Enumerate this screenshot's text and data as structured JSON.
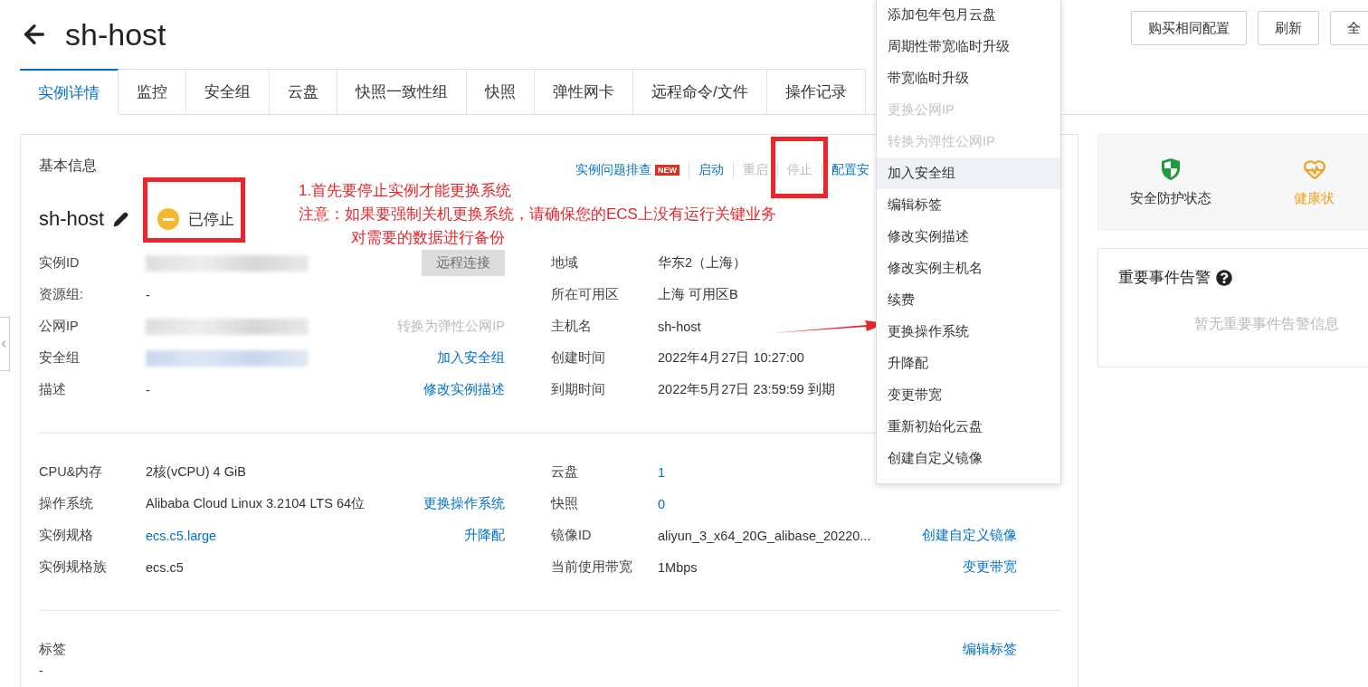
{
  "header": {
    "title": "sh-host",
    "buttons": [
      "购买相同配置",
      "刷新",
      "全"
    ]
  },
  "tabs": [
    {
      "label": "实例详情",
      "selected": true
    },
    {
      "label": "监控",
      "selected": false
    },
    {
      "label": "安全组",
      "selected": false
    },
    {
      "label": "云盘",
      "selected": false
    },
    {
      "label": "快照一致性组",
      "selected": false
    },
    {
      "label": "快照",
      "selected": false
    },
    {
      "label": "弹性网卡",
      "selected": false
    },
    {
      "label": "远程命令/文件",
      "selected": false
    },
    {
      "label": "操作记录",
      "selected": false
    }
  ],
  "basic_info": {
    "title": "基本信息",
    "actions": [
      {
        "label": "实例问题排查",
        "badge": "NEW",
        "disabled": false
      },
      {
        "label": "启动",
        "disabled": false
      },
      {
        "label": "重启",
        "disabled": true
      },
      {
        "label": "停止",
        "disabled": true
      },
      {
        "label": "配置安",
        "disabled": false
      }
    ],
    "instance_name": "sh-host",
    "status": {
      "kind": "stopped",
      "label": "已停止"
    },
    "sections": [
      {
        "left": [
          {
            "label": "实例ID",
            "value": {
              "kind": "redacted"
            },
            "action": {
              "kind": "button",
              "label": "远程连接",
              "disabled": true
            }
          },
          {
            "label": "资源组:",
            "value": {
              "kind": "text",
              "text": "-"
            }
          },
          {
            "label": "公网IP",
            "value": {
              "kind": "redacted"
            },
            "action": {
              "kind": "link",
              "label": "转换为弹性公网IP",
              "disabled": true
            }
          },
          {
            "label": "安全组",
            "value": {
              "kind": "redacted-link"
            },
            "action": {
              "kind": "link",
              "label": "加入安全组",
              "disabled": false
            }
          },
          {
            "label": "描述",
            "value": {
              "kind": "text",
              "text": "-"
            },
            "action": {
              "kind": "link",
              "label": "修改实例描述",
              "disabled": false
            }
          }
        ],
        "right": [
          {
            "label": "地域",
            "value": {
              "kind": "text",
              "text": "华东2（上海）"
            }
          },
          {
            "label": "所在可用区",
            "value": {
              "kind": "text",
              "text": "上海 可用区B"
            }
          },
          {
            "label": "主机名",
            "value": {
              "kind": "text",
              "text": "sh-host"
            }
          },
          {
            "label": "创建时间",
            "value": {
              "kind": "text",
              "text": "2022年4月27日 10:27:00"
            }
          },
          {
            "label": "到期时间",
            "value": {
              "kind": "text",
              "text": "2022年5月27日 23:59:59 到期"
            }
          }
        ]
      },
      {
        "left": [
          {
            "label": "CPU&内存",
            "value": {
              "kind": "text",
              "text": "2核(vCPU) 4 GiB"
            }
          },
          {
            "label": "操作系统",
            "value": {
              "kind": "text",
              "text": "Alibaba Cloud Linux 3.2104 LTS 64位"
            },
            "action": {
              "kind": "link",
              "label": "更换操作系统",
              "disabled": false
            }
          },
          {
            "label": "实例规格",
            "value": {
              "kind": "link",
              "text": "ecs.c5.large"
            },
            "action": {
              "kind": "link",
              "label": "升降配",
              "disabled": false
            }
          },
          {
            "label": "实例规格族",
            "value": {
              "kind": "text",
              "text": "ecs.c5"
            }
          }
        ],
        "right": [
          {
            "label": "云盘",
            "value": {
              "kind": "link",
              "text": "1"
            }
          },
          {
            "label": "快照",
            "value": {
              "kind": "link",
              "text": "0"
            }
          },
          {
            "label": "镜像ID",
            "value": {
              "kind": "text",
              "text": "aliyun_3_x64_20G_alibase_20220..."
            },
            "action": {
              "kind": "link",
              "label": "创建自定义镜像",
              "disabled": false
            }
          },
          {
            "label": "当前使用带宽",
            "value": {
              "kind": "text",
              "text": "1Mbps"
            },
            "action": {
              "kind": "link",
              "label": "变更带宽",
              "disabled": false
            }
          }
        ]
      }
    ],
    "tags": {
      "label": "标签",
      "value": "-",
      "action": "编辑标签"
    }
  },
  "more_menu": {
    "items": [
      {
        "label": "添加包年包月云盘",
        "disabled": false,
        "selected": false
      },
      {
        "label": "周期性带宽临时升级",
        "disabled": false,
        "selected": false
      },
      {
        "label": "带宽临时升级",
        "disabled": false,
        "selected": false
      },
      {
        "label": "更换公网IP",
        "disabled": true,
        "selected": false
      },
      {
        "label": "转换为弹性公网IP",
        "disabled": true,
        "selected": false
      },
      {
        "label": "加入安全组",
        "disabled": false,
        "selected": true
      },
      {
        "label": "编辑标签",
        "disabled": false,
        "selected": false
      },
      {
        "label": "修改实例描述",
        "disabled": false,
        "selected": false
      },
      {
        "label": "修改实例主机名",
        "disabled": false,
        "selected": false
      },
      {
        "label": "续费",
        "disabled": false,
        "selected": false
      },
      {
        "label": "更换操作系统",
        "disabled": false,
        "selected": false
      },
      {
        "label": "升降配",
        "disabled": false,
        "selected": false
      },
      {
        "label": "变更带宽",
        "disabled": false,
        "selected": false
      },
      {
        "label": "重新初始化云盘",
        "disabled": false,
        "selected": false
      },
      {
        "label": "创建自定义镜像",
        "disabled": false,
        "selected": false
      }
    ]
  },
  "status_cards": [
    {
      "kind": "security",
      "label": "安全防护状态"
    },
    {
      "kind": "health",
      "label": "健康状"
    }
  ],
  "events": {
    "title": "重要事件告警",
    "empty": "暂无重要事件告警信息"
  },
  "annotation": {
    "notes": [
      {
        "text": "1.首先要停止实例才能更换系统",
        "indented": false
      },
      {
        "text": "注意：如果要强制关机更换系统，请确保您的ECS上没有运行关键业务",
        "indented": false
      },
      {
        "text": "对需要的数据进行备份",
        "indented": true
      }
    ]
  }
}
